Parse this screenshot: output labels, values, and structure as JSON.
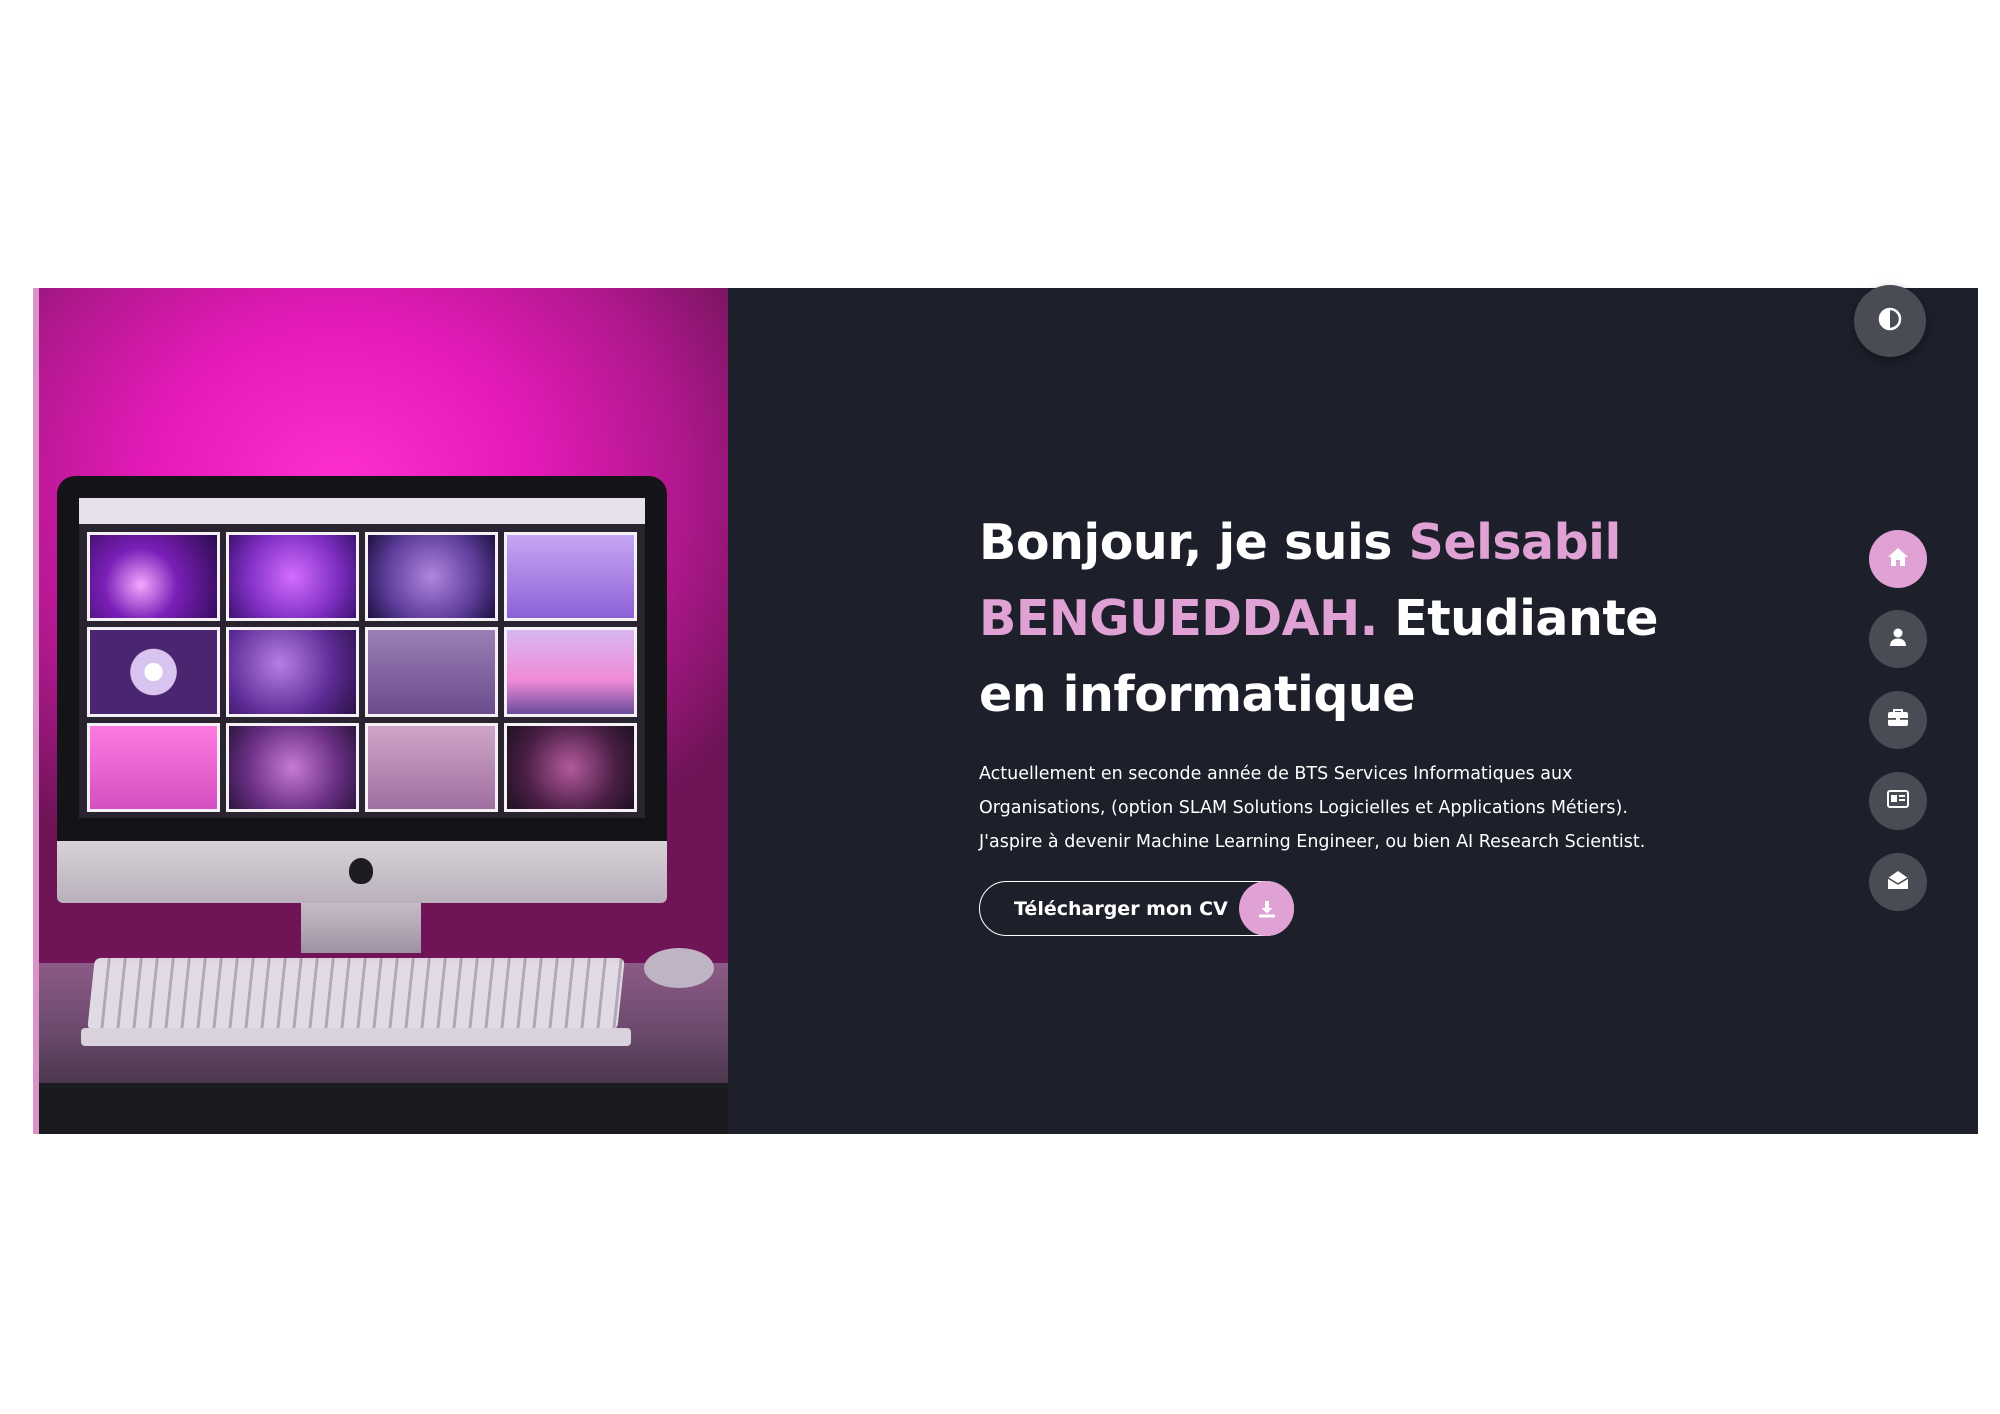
{
  "hero": {
    "title_prefix": "Bonjour, je suis ",
    "name": "Selsabil BENGUEDDAH.",
    "title_suffix": " Etudiante en informatique",
    "description_line1": "Actuellement en seconde année de BTS Services Informatiques aux",
    "description_line2": "Organisations, (option SLAM Solutions Logicielles et Applications Métiers).",
    "description_line3": "J'aspire à devenir Machine Learning Engineer, ou bien AI Research Scientist.",
    "cv_button_label": "Télécharger mon CV",
    "cv_icon": "download-icon"
  },
  "controls": {
    "theme_toggle_icon": "contrast-icon",
    "nav": [
      {
        "icon": "home-icon",
        "active": true
      },
      {
        "icon": "user-icon",
        "active": false
      },
      {
        "icon": "briefcase-icon",
        "active": false
      },
      {
        "icon": "id-card-icon",
        "active": false
      },
      {
        "icon": "envelope-open-icon",
        "active": false
      }
    ]
  },
  "colors": {
    "background": "#1d1f2b",
    "accent": "#e0a1d4",
    "nav_button": "#4a4c55",
    "text": "#ffffff"
  }
}
